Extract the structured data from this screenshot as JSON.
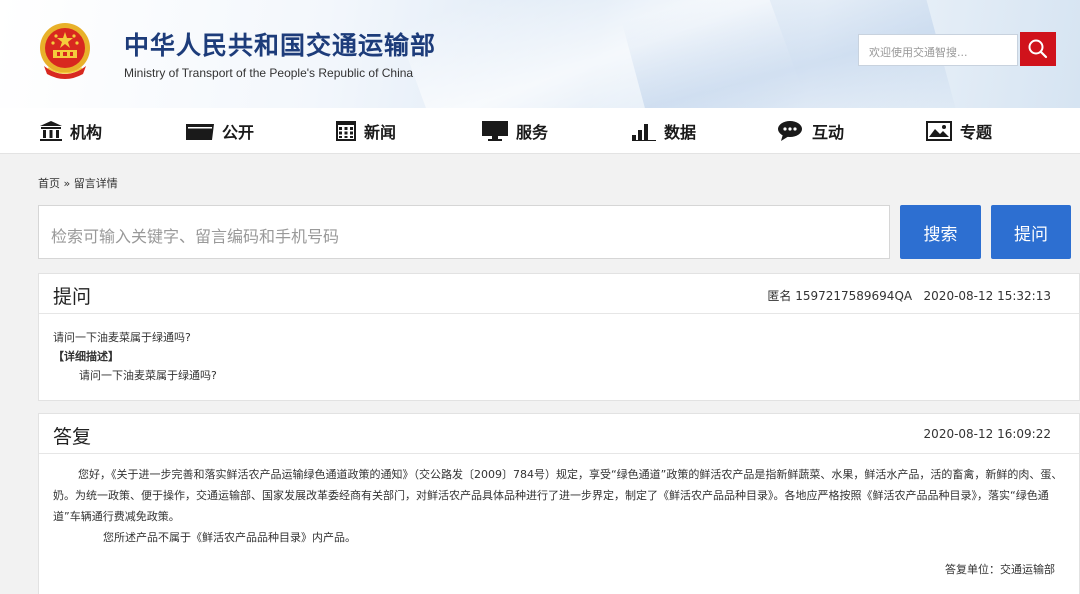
{
  "header": {
    "title": "中华人民共和国交通运输部",
    "subtitle": "Ministry of Transport of the People's Republic of China",
    "search_placeholder": "欢迎使用交通智搜...",
    "accent_color": "#d0121b"
  },
  "nav": {
    "items": [
      {
        "label": "机构",
        "icon": "building-icon"
      },
      {
        "label": "公开",
        "icon": "folder-icon"
      },
      {
        "label": "新闻",
        "icon": "calendar-grid-icon"
      },
      {
        "label": "服务",
        "icon": "monitor-icon"
      },
      {
        "label": "数据",
        "icon": "bar-chart-icon"
      },
      {
        "label": "互动",
        "icon": "chat-bubble-icon"
      },
      {
        "label": "专题",
        "icon": "image-icon"
      }
    ]
  },
  "breadcrumb": "首页 » 留言详情",
  "search": {
    "placeholder": "检索可输入关键字、留言编码和手机号码",
    "search_label": "搜索",
    "ask_label": "提问"
  },
  "question": {
    "heading": "提问",
    "meta": "匿名 1597217589694QA   2020-08-12 15:32:13",
    "text": "请问一下油麦菜属于绿通吗?",
    "detail_label": "【详细描述】",
    "detail_text": "请问一下油麦菜属于绿通吗?"
  },
  "answer": {
    "heading": "答复",
    "time": "2020-08-12 16:09:22",
    "paragraph1": "您好，《关于进一步完善和落实鲜活农产品运输绿色通道政策的通知》（交公路发〔2009〕784号）规定，享受“绿色通道”政策的鲜活农产品是指新鲜蔬菜、水果，鲜活水产品，活的畜禽，新鲜的肉、蛋、奶。为统一政策、便于操作，交通运输部、国家发展改革委经商有关部门，对鲜活农产品具体品种进行了进一步界定，制定了《鲜活农产品品种目录》。各地应严格按照《鲜活农产品品种目录》，落实“绿色通道”车辆通行费减免政策。",
    "paragraph2": "您所述产品不属于《鲜活农产品品种目录》内产品。",
    "unit": "答复单位：交通运输部"
  },
  "colors": {
    "primary_blue": "#2d6fd1",
    "title_blue": "#1d3c7a"
  }
}
